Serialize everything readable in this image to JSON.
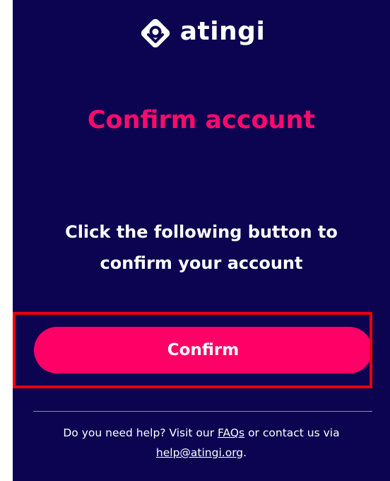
{
  "brand": {
    "name": "atingi",
    "logo_icon": "atingi-diamond-logo-icon"
  },
  "page": {
    "title": "Confirm account",
    "message": "Click the following button to confirm your account"
  },
  "actions": {
    "confirm_label": "Confirm"
  },
  "footer": {
    "help_prefix": "Do you need help? Visit our",
    "faqs_link": "FAQs",
    "help_middle": "or contact us via",
    "email_link": "help@atingi.org",
    "help_suffix": "."
  },
  "colors": {
    "background": "#0c0450",
    "accent": "#ff0066",
    "title": "#ff0a6c",
    "highlight_border": "#e8000f"
  }
}
